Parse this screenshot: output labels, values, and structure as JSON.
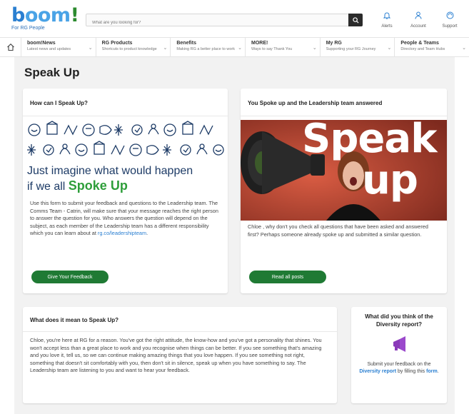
{
  "header": {
    "logo_text": "boom!",
    "logo_tagline": "For RG People",
    "search_placeholder": "What are you looking for?",
    "icons": [
      {
        "name": "bell-icon",
        "label": "Alerts"
      },
      {
        "name": "user-icon",
        "label": "Account"
      },
      {
        "name": "help-icon",
        "label": "Support"
      }
    ]
  },
  "nav": {
    "items": [
      {
        "title": "boom!News",
        "subtitle": "Latest news and updates"
      },
      {
        "title": "RG Products",
        "subtitle": "Shortcuts to product knowledge"
      },
      {
        "title": "Benefits",
        "subtitle": "Making RG a better place to work"
      },
      {
        "title": "MORE!",
        "subtitle": "Ways to say Thank You"
      },
      {
        "title": "My RG",
        "subtitle": "Supporting your RG Journey"
      },
      {
        "title": "People & Teams",
        "subtitle": "Directory and Team Hubs"
      }
    ]
  },
  "page": {
    "title": "Speak Up"
  },
  "card_how": {
    "heading": "How can I Speak Up?",
    "banner_line1": "Just imagine what would happen",
    "banner_line2_prefix": "if we all ",
    "banner_line2_emph": "Spoke Up",
    "body": "Use this form to submit your feedback and questions to the Leadership team. The Comms Team - Catrin, will make sure that your message reaches the right person to answer the question for you. Who answers the question will depend on the subject, as each member of the Leadership team has a different responsibility which you can learn about at ",
    "link_text": "rg.co/leadershipteam",
    "link_suffix": ".",
    "button": "Give Your Feedback"
  },
  "card_answered": {
    "heading": "You Spoke up and the Leadership team answered",
    "hero_word1": "Speak",
    "hero_word2": "up",
    "body": "Chloe , why don't you check all questions that have been asked and answered first? Perhaps someone already spoke up and submitted a similar question.",
    "button": "Read all posts"
  },
  "card_meaning": {
    "heading": "What does it mean to Speak Up?",
    "body": "Chloe, you're here at RG for a reason. You've got the right attitude, the know-how and you've got a personality that shines. You won't accept less than a great place to work and you recognise when things can be better. If you see something that's amazing and you love it, tell us, so we can continue making amazing things that you love happen. If you see something not right, something that doesn't sit comfortably with you, then don't sit in silence, speak up when you have something to say. The Leadership team are listening to you and want to hear your feedback."
  },
  "card_diversity": {
    "question": "What did you think of the Diversity report?",
    "text_1": "Submit your feedback on the ",
    "link_1": "Diversity report",
    "text_2": " by filling this ",
    "link_2": "form",
    "text_3": "."
  },
  "colors": {
    "brand_blue": "#2a7fd1",
    "button_green": "#1f7a34",
    "accent_green": "#2e9e3a",
    "hero_red": "#c24a36",
    "megaphone_purple": "#8a3ab9"
  }
}
